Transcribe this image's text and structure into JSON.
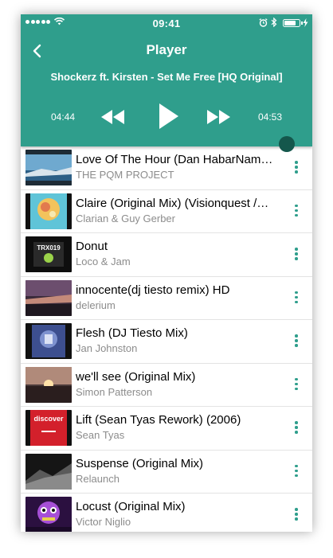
{
  "status_bar": {
    "time": "09:41",
    "signal_dots": 5,
    "battery_level": 0.8
  },
  "header": {
    "title": "Player",
    "back_icon": "chevron-left-icon"
  },
  "now_playing": {
    "track": "Shockerz ft. Kirsten - Set Me Free [HQ Original]",
    "elapsed": "04:44",
    "duration": "04:53",
    "progress": 0.97
  },
  "controls": {
    "rewind_icon": "rewind-icon",
    "play_icon": "play-icon",
    "forward_icon": "fast-forward-icon"
  },
  "colors": {
    "accent": "#2f9e8c",
    "knob": "#14574c",
    "subtitle": "#8c8c8c"
  },
  "playlist": [
    {
      "title": "Love Of The Hour (Dan HabarNam…",
      "artist": "THE PQM PROJECT"
    },
    {
      "title": "Claire (Original Mix) (Visionquest /…",
      "artist": "Clarian & Guy Gerber"
    },
    {
      "title": "Donut",
      "artist": "Loco & Jam",
      "cover_text": "TRX019"
    },
    {
      "title": "innocente(dj tiesto remix) HD",
      "artist": "delerium"
    },
    {
      "title": "Flesh (DJ Tiesto Mix)",
      "artist": "Jan Johnston"
    },
    {
      "title": "we'll see (Original Mix)",
      "artist": "Simon Patterson"
    },
    {
      "title": "Lift (Sean Tyas Rework) (2006)",
      "artist": "Sean Tyas",
      "cover_text": "discover"
    },
    {
      "title": "Suspense (Original Mix)",
      "artist": "Relaunch"
    },
    {
      "title": "Locust (Original Mix)",
      "artist": "Victor Niglio"
    }
  ]
}
